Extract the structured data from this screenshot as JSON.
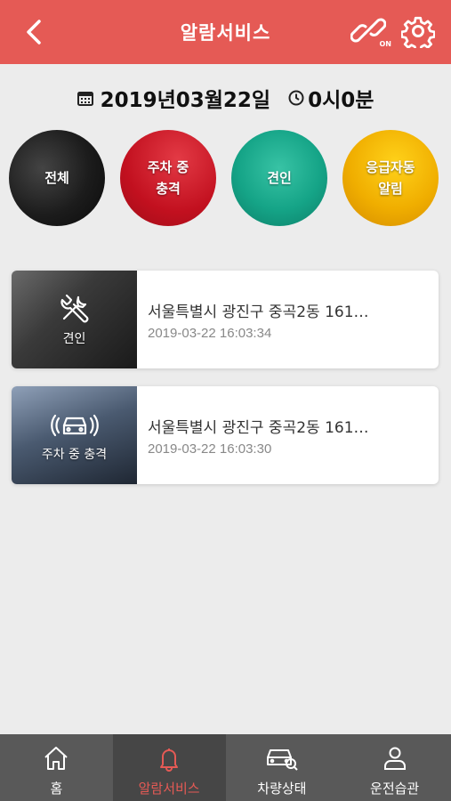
{
  "header": {
    "title": "알람서비스",
    "link_status": "ON"
  },
  "datebar": {
    "date": "2019년03월22일",
    "time": "0시0분"
  },
  "filters": [
    {
      "label": "전체",
      "color": "#1c1c1c"
    },
    {
      "label": "주차 중\n충격",
      "color": "#c2101f"
    },
    {
      "label": "견인",
      "color": "#15a487"
    },
    {
      "label": "응급자동\n알림",
      "color": "#f0ae00"
    }
  ],
  "alerts": [
    {
      "type": "견인",
      "icon": "tools-icon",
      "address": "서울특별시 광진구 중곡2동 161…",
      "time": "2019-03-22 16:03:34"
    },
    {
      "type": "주차 중 충격",
      "icon": "car-impact-icon",
      "address": "서울특별시 광진구 중곡2동 161…",
      "time": "2019-03-22 16:03:30"
    }
  ],
  "tabbar": {
    "active_color": "#e55a55",
    "tabs": [
      {
        "label": "홈",
        "icon": "home-icon"
      },
      {
        "label": "알람서비스",
        "icon": "bell-icon"
      },
      {
        "label": "차량상태",
        "icon": "car-search-icon"
      },
      {
        "label": "운전습관",
        "icon": "person-icon"
      }
    ]
  }
}
